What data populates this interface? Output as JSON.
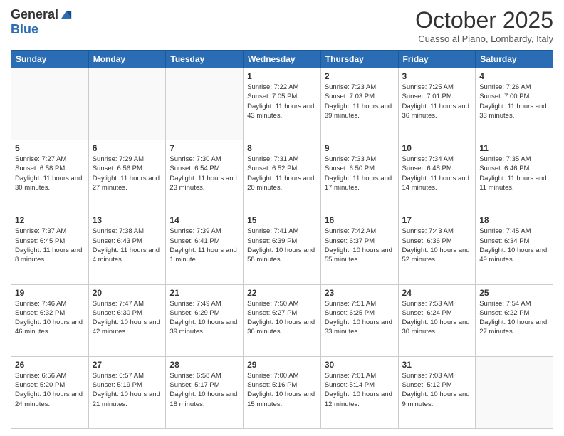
{
  "header": {
    "logo_general": "General",
    "logo_blue": "Blue",
    "month_title": "October 2025",
    "location": "Cuasso al Piano, Lombardy, Italy"
  },
  "days_of_week": [
    "Sunday",
    "Monday",
    "Tuesday",
    "Wednesday",
    "Thursday",
    "Friday",
    "Saturday"
  ],
  "weeks": [
    [
      {
        "day": "",
        "info": ""
      },
      {
        "day": "",
        "info": ""
      },
      {
        "day": "",
        "info": ""
      },
      {
        "day": "1",
        "info": "Sunrise: 7:22 AM\nSunset: 7:05 PM\nDaylight: 11 hours and 43 minutes."
      },
      {
        "day": "2",
        "info": "Sunrise: 7:23 AM\nSunset: 7:03 PM\nDaylight: 11 hours and 39 minutes."
      },
      {
        "day": "3",
        "info": "Sunrise: 7:25 AM\nSunset: 7:01 PM\nDaylight: 11 hours and 36 minutes."
      },
      {
        "day": "4",
        "info": "Sunrise: 7:26 AM\nSunset: 7:00 PM\nDaylight: 11 hours and 33 minutes."
      }
    ],
    [
      {
        "day": "5",
        "info": "Sunrise: 7:27 AM\nSunset: 6:58 PM\nDaylight: 11 hours and 30 minutes."
      },
      {
        "day": "6",
        "info": "Sunrise: 7:29 AM\nSunset: 6:56 PM\nDaylight: 11 hours and 27 minutes."
      },
      {
        "day": "7",
        "info": "Sunrise: 7:30 AM\nSunset: 6:54 PM\nDaylight: 11 hours and 23 minutes."
      },
      {
        "day": "8",
        "info": "Sunrise: 7:31 AM\nSunset: 6:52 PM\nDaylight: 11 hours and 20 minutes."
      },
      {
        "day": "9",
        "info": "Sunrise: 7:33 AM\nSunset: 6:50 PM\nDaylight: 11 hours and 17 minutes."
      },
      {
        "day": "10",
        "info": "Sunrise: 7:34 AM\nSunset: 6:48 PM\nDaylight: 11 hours and 14 minutes."
      },
      {
        "day": "11",
        "info": "Sunrise: 7:35 AM\nSunset: 6:46 PM\nDaylight: 11 hours and 11 minutes."
      }
    ],
    [
      {
        "day": "12",
        "info": "Sunrise: 7:37 AM\nSunset: 6:45 PM\nDaylight: 11 hours and 8 minutes."
      },
      {
        "day": "13",
        "info": "Sunrise: 7:38 AM\nSunset: 6:43 PM\nDaylight: 11 hours and 4 minutes."
      },
      {
        "day": "14",
        "info": "Sunrise: 7:39 AM\nSunset: 6:41 PM\nDaylight: 11 hours and 1 minute."
      },
      {
        "day": "15",
        "info": "Sunrise: 7:41 AM\nSunset: 6:39 PM\nDaylight: 10 hours and 58 minutes."
      },
      {
        "day": "16",
        "info": "Sunrise: 7:42 AM\nSunset: 6:37 PM\nDaylight: 10 hours and 55 minutes."
      },
      {
        "day": "17",
        "info": "Sunrise: 7:43 AM\nSunset: 6:36 PM\nDaylight: 10 hours and 52 minutes."
      },
      {
        "day": "18",
        "info": "Sunrise: 7:45 AM\nSunset: 6:34 PM\nDaylight: 10 hours and 49 minutes."
      }
    ],
    [
      {
        "day": "19",
        "info": "Sunrise: 7:46 AM\nSunset: 6:32 PM\nDaylight: 10 hours and 46 minutes."
      },
      {
        "day": "20",
        "info": "Sunrise: 7:47 AM\nSunset: 6:30 PM\nDaylight: 10 hours and 42 minutes."
      },
      {
        "day": "21",
        "info": "Sunrise: 7:49 AM\nSunset: 6:29 PM\nDaylight: 10 hours and 39 minutes."
      },
      {
        "day": "22",
        "info": "Sunrise: 7:50 AM\nSunset: 6:27 PM\nDaylight: 10 hours and 36 minutes."
      },
      {
        "day": "23",
        "info": "Sunrise: 7:51 AM\nSunset: 6:25 PM\nDaylight: 10 hours and 33 minutes."
      },
      {
        "day": "24",
        "info": "Sunrise: 7:53 AM\nSunset: 6:24 PM\nDaylight: 10 hours and 30 minutes."
      },
      {
        "day": "25",
        "info": "Sunrise: 7:54 AM\nSunset: 6:22 PM\nDaylight: 10 hours and 27 minutes."
      }
    ],
    [
      {
        "day": "26",
        "info": "Sunrise: 6:56 AM\nSunset: 5:20 PM\nDaylight: 10 hours and 24 minutes."
      },
      {
        "day": "27",
        "info": "Sunrise: 6:57 AM\nSunset: 5:19 PM\nDaylight: 10 hours and 21 minutes."
      },
      {
        "day": "28",
        "info": "Sunrise: 6:58 AM\nSunset: 5:17 PM\nDaylight: 10 hours and 18 minutes."
      },
      {
        "day": "29",
        "info": "Sunrise: 7:00 AM\nSunset: 5:16 PM\nDaylight: 10 hours and 15 minutes."
      },
      {
        "day": "30",
        "info": "Sunrise: 7:01 AM\nSunset: 5:14 PM\nDaylight: 10 hours and 12 minutes."
      },
      {
        "day": "31",
        "info": "Sunrise: 7:03 AM\nSunset: 5:12 PM\nDaylight: 10 hours and 9 minutes."
      },
      {
        "day": "",
        "info": ""
      }
    ]
  ]
}
